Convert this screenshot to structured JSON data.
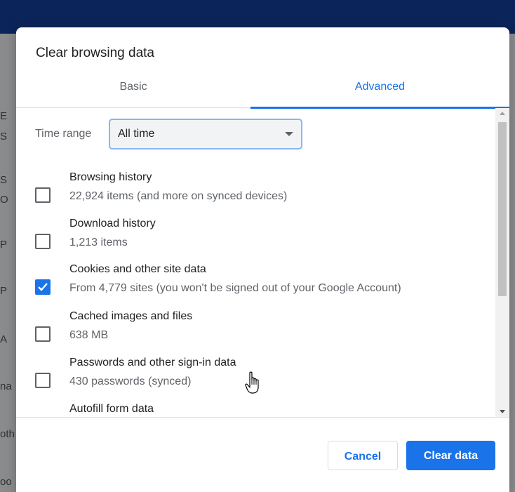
{
  "dialog": {
    "title": "Clear browsing data",
    "tabs": [
      {
        "label": "Basic",
        "selected": false
      },
      {
        "label": "Advanced",
        "selected": true
      }
    ],
    "time_range": {
      "label": "Time range",
      "value": "All time"
    },
    "items": [
      {
        "title": "Browsing history",
        "subtitle": "22,924 items (and more on synced devices)",
        "checked": false
      },
      {
        "title": "Download history",
        "subtitle": "1,213 items",
        "checked": false
      },
      {
        "title": "Cookies and other site data",
        "subtitle": "From 4,779 sites (you won't be signed out of your Google Account)",
        "checked": true
      },
      {
        "title": "Cached images and files",
        "subtitle": "638 MB",
        "checked": false
      },
      {
        "title": "Passwords and other sign-in data",
        "subtitle": "430 passwords (synced)",
        "checked": false
      },
      {
        "title": "Autofill form data",
        "subtitle": "",
        "checked": false
      }
    ],
    "buttons": {
      "cancel": "Cancel",
      "clear": "Clear data"
    }
  },
  "background": {
    "fragments": [
      "E",
      "S",
      "S",
      "O",
      "P",
      "P",
      "A",
      "na",
      "oth",
      "oo"
    ]
  },
  "colors": {
    "accent": "#1a73e8",
    "top_bar": "#0b2459"
  }
}
